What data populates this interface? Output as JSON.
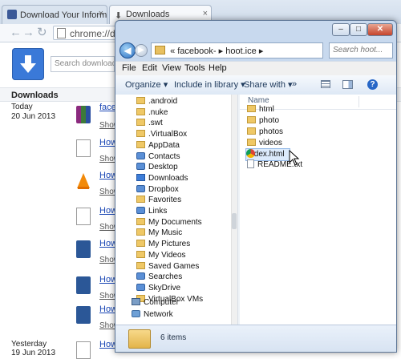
{
  "chrome": {
    "tabs": [
      {
        "label": "Download Your Informatic"
      },
      {
        "label": "Downloads"
      }
    ],
    "address": "chrome://do",
    "search_placeholder": "Search downloads",
    "section_title": "Downloads"
  },
  "downloads": [
    {
      "date": "Today",
      "date_sub": "20 Jun 2013",
      "name": "faceb",
      "show": "Show"
    },
    {
      "name": "How",
      "show": "Show"
    },
    {
      "name": "How",
      "show": "Show"
    },
    {
      "name": "How",
      "show": "Show"
    },
    {
      "name": "How",
      "show": "Show"
    },
    {
      "name": "How",
      "show": "Show"
    },
    {
      "name": "How",
      "show": "Show"
    },
    {
      "date": "Yesterday",
      "date_sub": "19 Jun 2013",
      "name": "How",
      "show": "Show"
    }
  ],
  "explorer": {
    "address": [
      "«",
      "facebook-",
      "▸",
      "hoot.ice",
      "▸"
    ],
    "search_placeholder": "Search hoot...",
    "menu": [
      "File",
      "Edit",
      "View",
      "Tools",
      "Help"
    ],
    "commands": {
      "organize": "Organize ▾",
      "include": "Include in library ▾",
      "share": "Share with ▾",
      "more": "»"
    },
    "nav_items": [
      {
        "label": ".android",
        "icon": "folder"
      },
      {
        "label": ".nuke",
        "icon": "folder"
      },
      {
        "label": ".swt",
        "icon": "folder"
      },
      {
        "label": ".VirtualBox",
        "icon": "folder"
      },
      {
        "label": "AppData",
        "icon": "folder"
      },
      {
        "label": "Contacts",
        "icon": "blue"
      },
      {
        "label": "Desktop",
        "icon": "blue"
      },
      {
        "label": "Downloads",
        "icon": "dl"
      },
      {
        "label": "Dropbox",
        "icon": "blue"
      },
      {
        "label": "Favorites",
        "icon": "folder"
      },
      {
        "label": "Links",
        "icon": "blue"
      },
      {
        "label": "My Documents",
        "icon": "folder"
      },
      {
        "label": "My Music",
        "icon": "folder"
      },
      {
        "label": "My Pictures",
        "icon": "folder"
      },
      {
        "label": "My Videos",
        "icon": "folder"
      },
      {
        "label": "Saved Games",
        "icon": "folder"
      },
      {
        "label": "Searches",
        "icon": "blue"
      },
      {
        "label": "SkyDrive",
        "icon": "blue"
      },
      {
        "label": "VirtualBox VMs",
        "icon": "folder"
      }
    ],
    "computer": "Computer",
    "network": "Network",
    "column": "Name",
    "files": [
      {
        "label": "html",
        "icon": "folder"
      },
      {
        "label": "photo",
        "icon": "folder"
      },
      {
        "label": "photos",
        "icon": "folder"
      },
      {
        "label": "videos",
        "icon": "folder"
      },
      {
        "label": "index.html",
        "icon": "chrome"
      },
      {
        "label": "README.txt",
        "icon": "txt"
      }
    ],
    "status": "6 items"
  }
}
